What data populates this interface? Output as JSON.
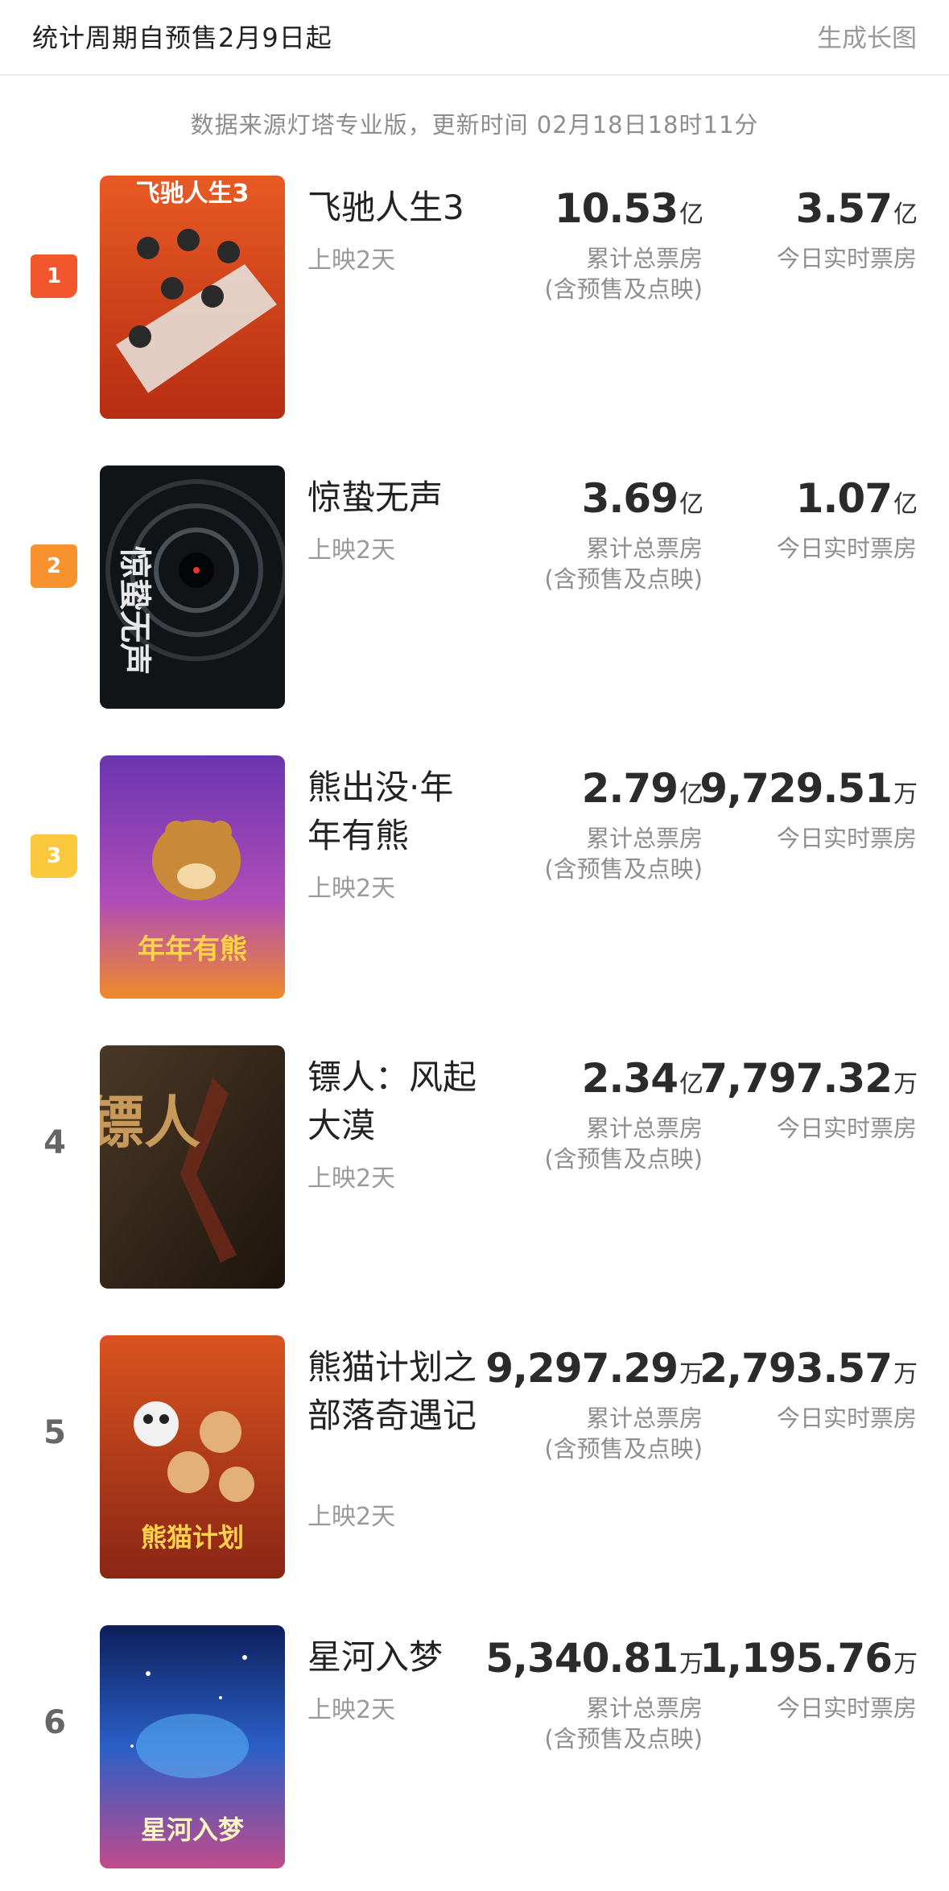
{
  "header": {
    "title": "统计周期自预售2月9日起",
    "action": "生成长图"
  },
  "source_text": "数据来源灯塔专业版，更新时间 02月18日18时11分",
  "labels": {
    "total_line1": "累计总票房",
    "total_line2": "(含预售及点映)",
    "today": "今日实时票房"
  },
  "badge_colors": {
    "1": "#f2562c",
    "2": "#f8922e",
    "3": "#f9c83d"
  },
  "movies": [
    {
      "rank": "1",
      "title": "飞驰人生3",
      "days": "上映2天",
      "total": "10.53",
      "total_unit": "亿",
      "today": "3.57",
      "today_unit": "亿",
      "poster_text": "飞驰人生3",
      "poster_color": "#e14a1f"
    },
    {
      "rank": "2",
      "title": "惊蛰无声",
      "days": "上映2天",
      "total": "3.69",
      "total_unit": "亿",
      "today": "1.07",
      "today_unit": "亿",
      "poster_text": "惊蛰无声",
      "poster_color": "#161a1c"
    },
    {
      "rank": "3",
      "title": "熊出没·年年有熊",
      "days": "上映2天",
      "total": "2.79",
      "total_unit": "亿",
      "today": "9,729.51",
      "today_unit": "万",
      "poster_text": "年年有熊",
      "poster_color": "#7a3fb3"
    },
    {
      "rank": "4",
      "title": "镖人：风起大漠",
      "days": "上映2天",
      "total": "2.34",
      "total_unit": "亿",
      "today": "7,797.32",
      "today_unit": "万",
      "poster_text": "镖人",
      "poster_color": "#3a2a1c"
    },
    {
      "rank": "5",
      "title": "熊猫计划之部落奇遇记",
      "days": "上映2天",
      "total": "9,297.29",
      "total_unit": "万",
      "today": "2,793.57",
      "today_unit": "万",
      "poster_text": "熊猫计划",
      "poster_color": "#c9411f"
    },
    {
      "rank": "6",
      "title": "星河入梦",
      "days": "上映2天",
      "total": "5,340.81",
      "total_unit": "万",
      "today": "1,195.76",
      "today_unit": "万",
      "poster_text": "星河入梦",
      "poster_color": "#1b3a8c"
    }
  ]
}
